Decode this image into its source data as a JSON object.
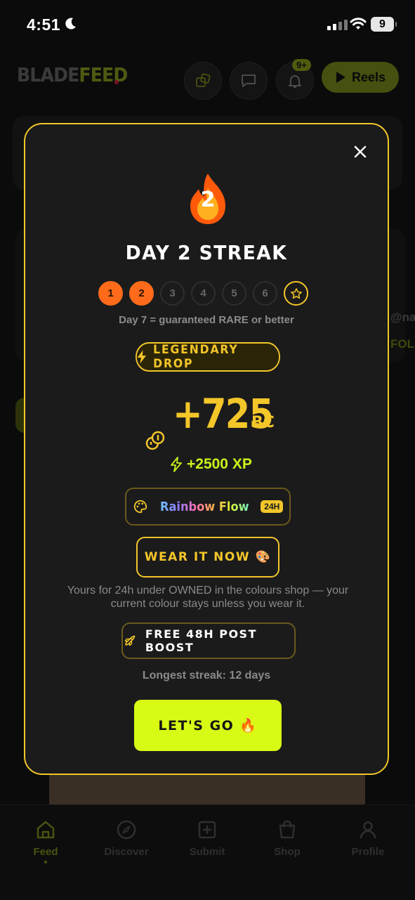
{
  "status_bar": {
    "time": "4:51",
    "battery": "9"
  },
  "header": {
    "logo_part1": "BLADE",
    "logo_part2": "FEED",
    "notification_badge": "9+",
    "reels_label": "Reels"
  },
  "background": {
    "handle_fragment": "@nat",
    "follow_fragment": "FOLL"
  },
  "nav": {
    "items": [
      {
        "label": "Feed",
        "icon": "home-icon",
        "active": true
      },
      {
        "label": "Discover",
        "icon": "compass-icon"
      },
      {
        "label": "Submit",
        "icon": "plus-square-icon"
      },
      {
        "label": "Shop",
        "icon": "bag-icon"
      },
      {
        "label": "Profile",
        "icon": "user-icon"
      }
    ]
  },
  "modal": {
    "streak_number": "2",
    "title": "DAY 2 STREAK",
    "days": [
      "1",
      "2",
      "3",
      "4",
      "5",
      "6"
    ],
    "days_completed": 2,
    "goal_icon": "star-icon",
    "hint": "Day 7 = guaranteed RARE or better",
    "drop_label": "LEGENDARY DROP",
    "bc_amount": "+725",
    "bc_unit": "BC",
    "xp": "+2500 XP",
    "reward_name": "Rainbow Flow",
    "reward_duration": "24H",
    "wear_label": "WEAR IT NOW 🎨",
    "note": "Yours for 24h under OWNED in the colours shop — your current colour stays unless you wear it.",
    "boost_label": "FREE 48H POST BOOST",
    "longest": "Longest streak: 12 days",
    "cta": "LET'S GO 🔥"
  },
  "colors": {
    "accent_yellow": "#f3c629",
    "lime": "#d8fa15",
    "orange": "#ff6b1a",
    "modal_bg": "#1b1b1c"
  }
}
